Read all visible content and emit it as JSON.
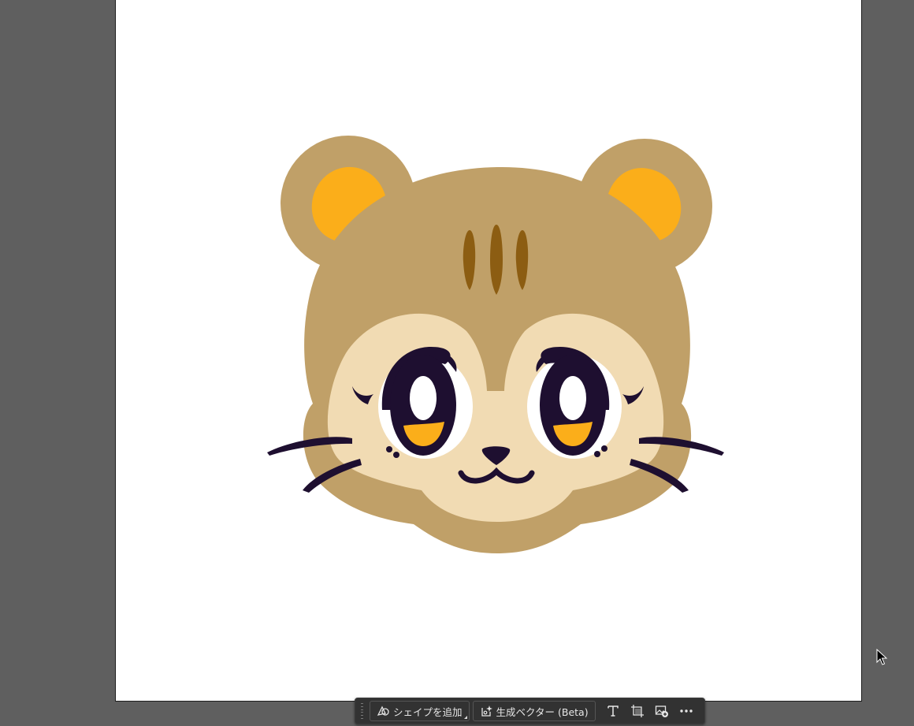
{
  "colors": {
    "workspace_bg": "#5f5f5f",
    "artboard_bg": "#ffffff",
    "toolbar_bg": "#323232",
    "toolbar_text": "#e6e6e6",
    "fur": "#c0a068",
    "inner_ear": "#fbae1a",
    "face_cream": "#f1dbb3",
    "forehead_stripes": "#8c5d12",
    "eye_dark": "#1e0f30",
    "iris_orange": "#fbae1a",
    "highlight": "#ffffff"
  },
  "taskbar": {
    "add_shape_label": "シェイプを追加",
    "add_shape_icon": "shape-icon",
    "generate_vector_label": "生成ベクター (Beta)",
    "generate_vector_icon": "sparkle-vector-icon",
    "type_icon": "type-icon",
    "crop_icon": "crop-artboard-icon",
    "place_image_icon": "place-image-icon",
    "more_icon": "more-icon"
  },
  "cursor_icon": "arrow-cursor-icon"
}
